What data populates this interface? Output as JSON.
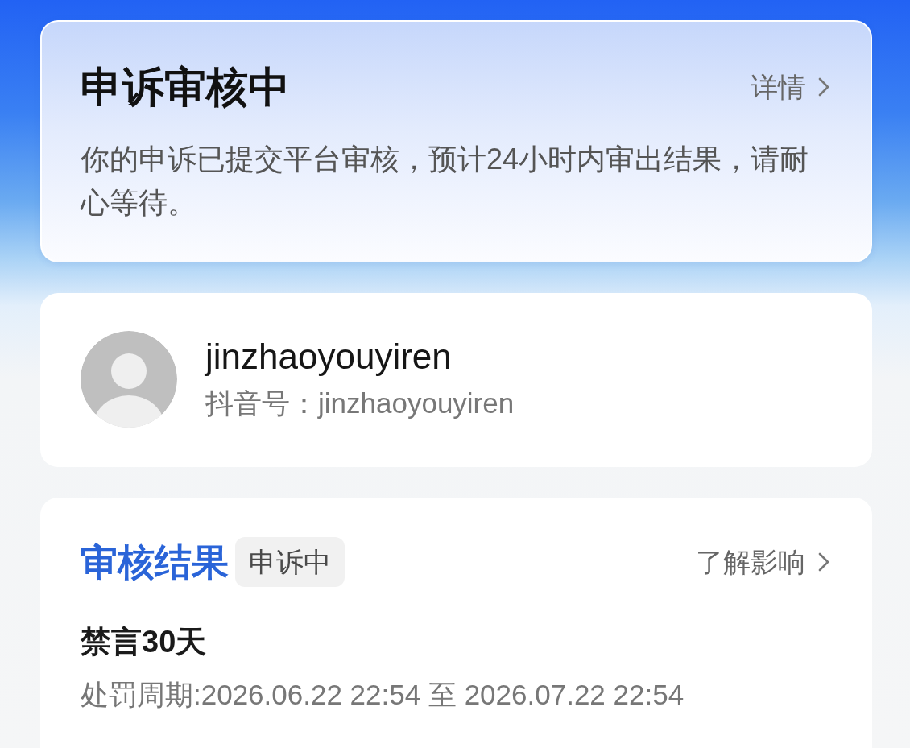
{
  "status_card": {
    "title": "申诉审核中",
    "link": "详情",
    "description": "你的申诉已提交平台审核，预计24小时内审出结果，请耐心等待。"
  },
  "account_card": {
    "username": "jinzhaoyouyiren",
    "account_id": "抖音号：jinzhaoyouyiren"
  },
  "result_card": {
    "title": "审核结果",
    "tag": "申诉中",
    "link": "了解影响",
    "penalty": "禁言30天",
    "period": "处罚周期:2026.06.22 22:54 至 2026.07.22 22:54"
  }
}
